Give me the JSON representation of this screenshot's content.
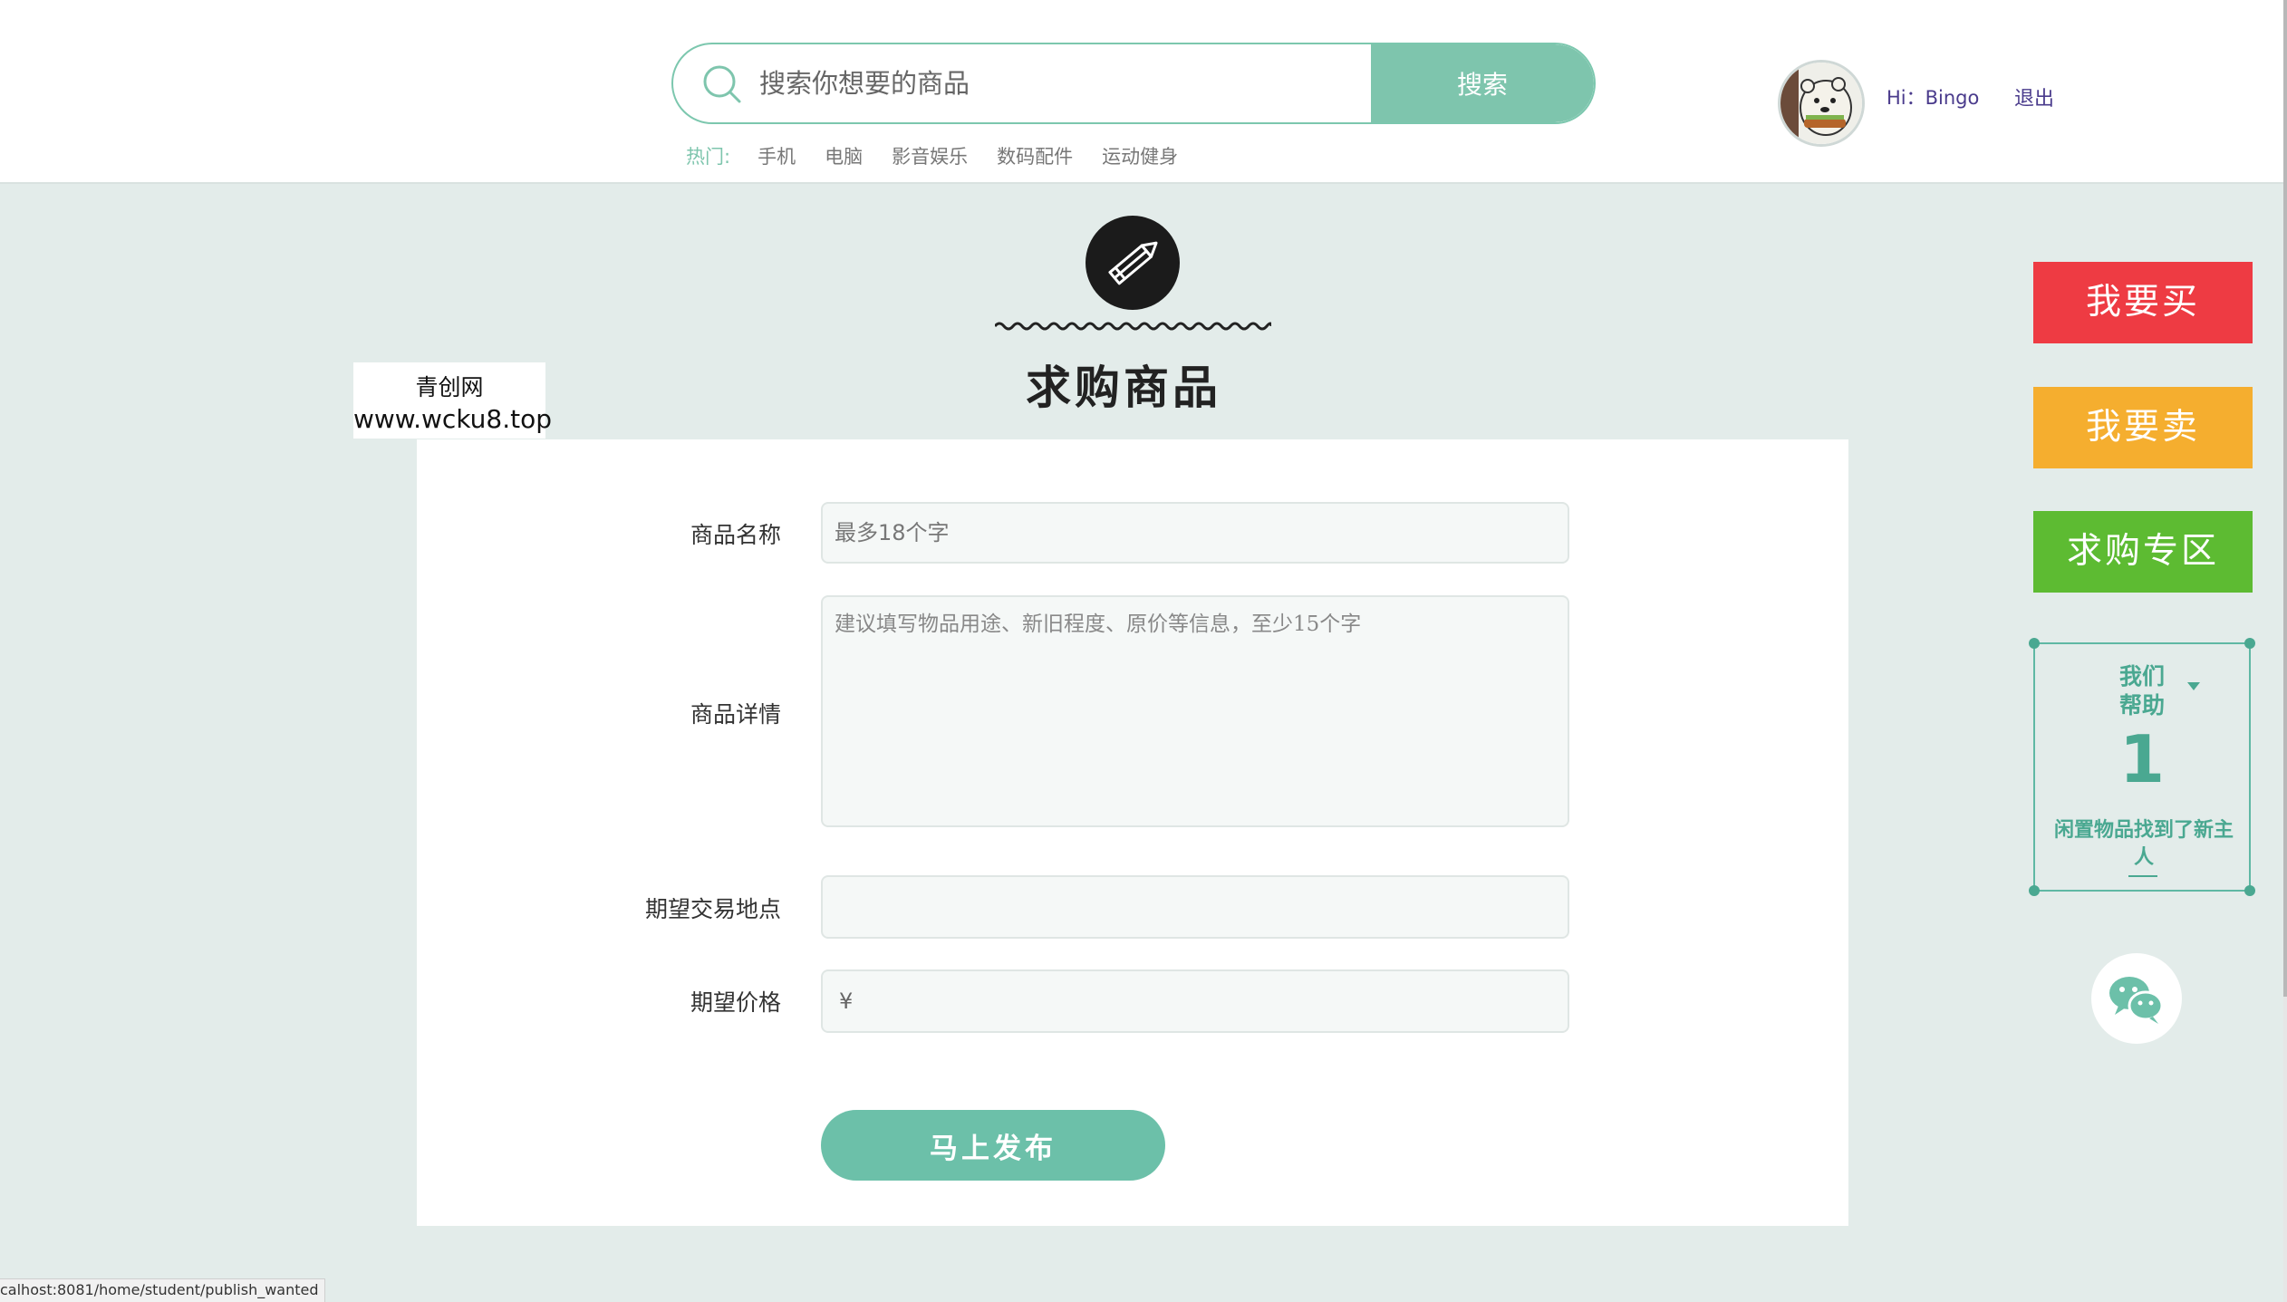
{
  "header": {
    "search": {
      "placeholder": "搜索你想要的商品",
      "button_label": "搜索"
    },
    "hot": {
      "label": "热门:",
      "items": [
        "手机",
        "电脑",
        "影音娱乐",
        "数码配件",
        "运动健身"
      ]
    },
    "user": {
      "greeting": "Hi：Bingo",
      "logout_label": "退出"
    }
  },
  "page": {
    "title": "求购商品",
    "watermark": {
      "line1": "青创网",
      "line2": "www.wcku8.top"
    }
  },
  "form": {
    "name": {
      "label": "商品名称",
      "placeholder": "最多18个字"
    },
    "detail": {
      "label": "商品详情",
      "placeholder": "建议填写物品用途、新旧程度、原价等信息，至少15个字"
    },
    "location": {
      "label": "期望交易地点",
      "placeholder": ""
    },
    "price": {
      "label": "期望价格",
      "symbol": "¥"
    },
    "submit_label": "马上发布"
  },
  "side": {
    "buy_label": "我要买",
    "sell_label": "我要卖",
    "wanted_label": "求购专区",
    "help": {
      "title_line1": "我们",
      "title_line2": "帮助",
      "count": "1",
      "desc": "闲置物品找到了新主人"
    },
    "wechat_icon": "wechat-icon"
  },
  "status_bar": {
    "url": "calhost:8081/home/student/publish_wanted"
  },
  "colors": {
    "accent": "#7ec5ad",
    "buy": "#ee3b43",
    "sell": "#f5ae2f",
    "wanted": "#5dbb32",
    "page_bg": "#e3ecea"
  }
}
